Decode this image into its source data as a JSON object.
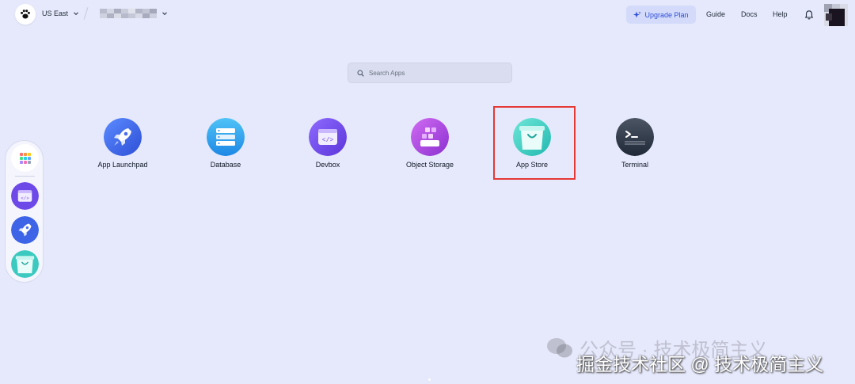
{
  "header": {
    "region": "US East",
    "upgrade_label": "Upgrade Plan",
    "nav": [
      "Guide",
      "Docs",
      "Help"
    ]
  },
  "search": {
    "placeholder": "Search Apps"
  },
  "apps": [
    {
      "label": "App Launchpad",
      "icon": "rocket-icon"
    },
    {
      "label": "Database",
      "icon": "database-icon"
    },
    {
      "label": "Devbox",
      "icon": "devbox-icon"
    },
    {
      "label": "Object Storage",
      "icon": "object-storage-icon"
    },
    {
      "label": "App Store",
      "icon": "app-store-bag-icon",
      "highlighted": true
    },
    {
      "label": "Terminal",
      "icon": "terminal-icon"
    }
  ],
  "dock": [
    "apps-grid-icon",
    "devbox-icon",
    "rocket-icon",
    "app-store-bag-icon"
  ],
  "watermark": {
    "line1": "公众号 · 技术极简主义",
    "line2": "掘金技术社区 @ 技术极简主义"
  },
  "colors": {
    "background": "#e6e9fb",
    "accent": "#2f4fd9",
    "highlight_border": "#e53935"
  }
}
